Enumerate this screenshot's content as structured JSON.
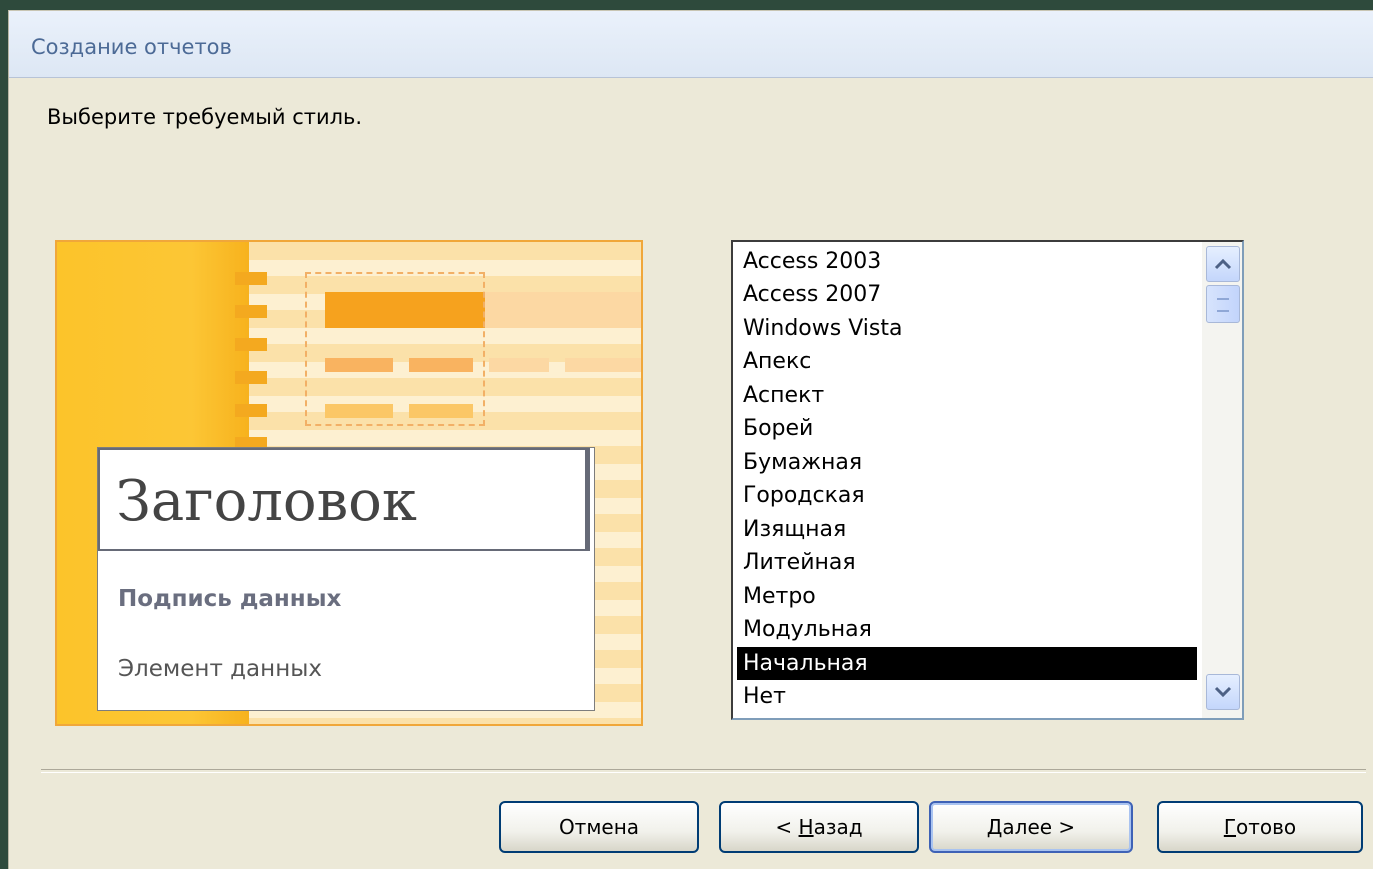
{
  "window": {
    "title": "Создание отчетов",
    "prompt": "Выберите требуемый стиль."
  },
  "preview": {
    "heading": "Заголовок",
    "caption": "Подпись данных",
    "item": "Элемент данных"
  },
  "style_list": {
    "items": [
      "Access 2003",
      "Access 2007",
      "Windows Vista",
      "Апекс",
      "Аспект",
      "Борей",
      "Бумажная",
      "Городская",
      "Изящная",
      "Литейная",
      "Метро",
      "Модульная",
      "Начальная",
      "Нет"
    ],
    "selected": "Начальная"
  },
  "buttons": {
    "cancel": "Отмена",
    "back_prefix": "< ",
    "back_mnemonic": "Н",
    "back_rest": "азад",
    "next_mnemonic": "Д",
    "next_rest": "алее >",
    "finish_mnemonic": "Г",
    "finish_rest": "отово"
  },
  "icons": {
    "scroll_up": "chevron-up-icon",
    "scroll_down": "chevron-down-icon"
  }
}
